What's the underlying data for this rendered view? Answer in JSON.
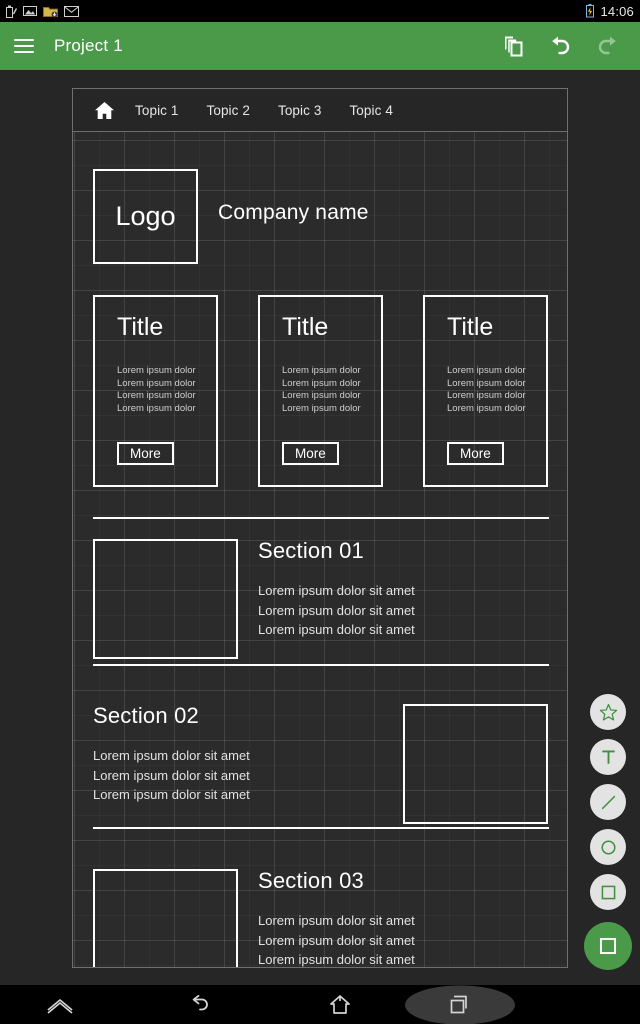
{
  "status_bar": {
    "icons": [
      "battery-pen-icon",
      "image-icon",
      "folder-download-icon",
      "mail-icon"
    ],
    "battery_icon": "battery-charging-icon",
    "clock": "14:06"
  },
  "app_bar": {
    "menu_icon": "hamburger-menu-icon",
    "title": "Project 1",
    "background": "#4a9a4a",
    "actions": [
      {
        "name": "layers-icon",
        "label": "Layers"
      },
      {
        "name": "undo-icon",
        "label": "Undo"
      },
      {
        "name": "redo-icon",
        "label": "Redo"
      }
    ]
  },
  "canvas": {
    "background": "#2b2b2b",
    "grid_color": "#3f3f3f",
    "nav": {
      "home_icon": "home-icon",
      "topics": [
        {
          "label": "Topic 1"
        },
        {
          "label": "Topic 2"
        },
        {
          "label": "Topic 3"
        },
        {
          "label": "Topic 4"
        }
      ]
    },
    "header": {
      "logo_label": "Logo",
      "company_name": "Company name"
    },
    "cards": [
      {
        "title": "Title",
        "lines": [
          "Lorem ipsum dolor",
          "Lorem ipsum dolor",
          "Lorem ipsum dolor",
          "Lorem ipsum dolor"
        ],
        "button": "More"
      },
      {
        "title": "Title",
        "lines": [
          "Lorem ipsum dolor",
          "Lorem ipsum dolor",
          "Lorem ipsum dolor",
          "Lorem ipsum dolor"
        ],
        "button": "More"
      },
      {
        "title": "Title",
        "lines": [
          "Lorem ipsum dolor",
          "Lorem ipsum dolor",
          "Lorem ipsum dolor",
          "Lorem ipsum dolor"
        ],
        "button": "More"
      }
    ],
    "sections": [
      {
        "heading": "Section 01",
        "image_side": "left",
        "lines": [
          "Lorem ipsum dolor sit amet",
          "Lorem ipsum dolor sit amet",
          "Lorem ipsum dolor sit amet"
        ]
      },
      {
        "heading": "Section 02",
        "image_side": "right",
        "lines": [
          "Lorem ipsum dolor sit amet",
          "Lorem ipsum dolor sit amet",
          "Lorem ipsum dolor sit amet"
        ]
      },
      {
        "heading": "Section 03",
        "image_side": "left",
        "lines": [
          "Lorem ipsum dolor sit amet",
          "Lorem ipsum dolor sit amet",
          "Lorem ipsum dolor sit amet"
        ]
      }
    ]
  },
  "tool_rail": {
    "accent": "#4a9a4a",
    "tools": [
      {
        "name": "star-tool-icon",
        "label": "Star",
        "active": false
      },
      {
        "name": "text-tool-icon",
        "label": "Text",
        "active": false
      },
      {
        "name": "line-tool-icon",
        "label": "Line",
        "active": false
      },
      {
        "name": "circle-tool-icon",
        "label": "Circle",
        "active": false
      },
      {
        "name": "square-tool-icon",
        "label": "Square",
        "active": false
      },
      {
        "name": "rectangle-tool-icon",
        "label": "Rectangle",
        "active": true
      }
    ]
  },
  "nav_bar": {
    "buttons": [
      {
        "name": "expand-icon",
        "label": "Expand"
      },
      {
        "name": "back-icon",
        "label": "Back"
      },
      {
        "name": "home-icon",
        "label": "Home"
      },
      {
        "name": "recents-icon",
        "label": "Recents"
      }
    ]
  }
}
